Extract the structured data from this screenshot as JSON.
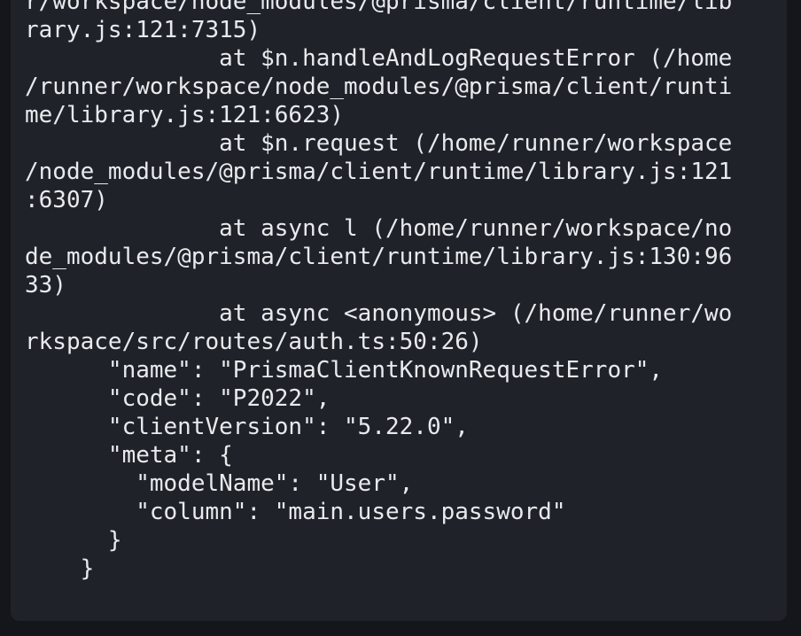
{
  "log": {
    "lines": [
      "r/workspace/node_modules/@prisma/client/runtime/lib",
      "rary.js:121:7315)",
      "              at $n.handleAndLogRequestError (/home",
      "/runner/workspace/node_modules/@prisma/client/runti",
      "me/library.js:121:6623)",
      "              at $n.request (/home/runner/workspace",
      "/node_modules/@prisma/client/runtime/library.js:121",
      ":6307)",
      "              at async l (/home/runner/workspace/no",
      "de_modules/@prisma/client/runtime/library.js:130:96",
      "33)",
      "              at async <anonymous> (/home/runner/wo",
      "rkspace/src/routes/auth.ts:50:26)",
      "      \"name\": \"PrismaClientKnownRequestError\",",
      "      \"code\": \"P2022\",",
      "      \"clientVersion\": \"5.22.0\",",
      "      \"meta\": {",
      "        \"modelName\": \"User\",",
      "        \"column\": \"main.users.password\"",
      "      }",
      "    }"
    ]
  }
}
